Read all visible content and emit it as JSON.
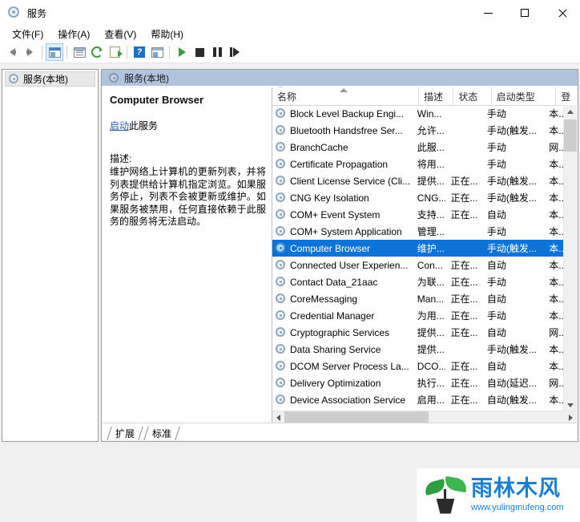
{
  "window": {
    "title": "服务",
    "icon": "services-gear-icon",
    "controls": {
      "minimize": "—",
      "maximize": "□",
      "close": "✕"
    }
  },
  "menubar": {
    "items": [
      {
        "label": "文件(F)",
        "name": "menu-file"
      },
      {
        "label": "操作(A)",
        "name": "menu-action"
      },
      {
        "label": "查看(V)",
        "name": "menu-view"
      },
      {
        "label": "帮助(H)",
        "name": "menu-help"
      }
    ]
  },
  "toolbar": {
    "buttons": [
      {
        "name": "back-button",
        "icon": "arrow-left-icon"
      },
      {
        "name": "forward-button",
        "icon": "arrow-right-icon"
      },
      {
        "name": "show-hide-tree-button",
        "icon": "tree-pane-icon",
        "selected": true
      },
      {
        "name": "properties-button",
        "icon": "properties-icon"
      },
      {
        "name": "refresh-button",
        "icon": "refresh-icon"
      },
      {
        "name": "export-list-button",
        "icon": "export-icon"
      },
      {
        "name": "help-button",
        "icon": "help-icon"
      },
      {
        "name": "console-view-button",
        "icon": "console-icon"
      },
      {
        "name": "start-service-button",
        "icon": "play-icon"
      },
      {
        "name": "stop-service-button",
        "icon": "stop-icon"
      },
      {
        "name": "pause-service-button",
        "icon": "pause-icon"
      },
      {
        "name": "restart-service-button",
        "icon": "restart-icon"
      }
    ]
  },
  "tree": {
    "root": {
      "label": "服务(本地)",
      "icon": "services-gear-icon",
      "selected": true
    }
  },
  "pane": {
    "header": {
      "label": "服务(本地)",
      "icon": "services-gear-icon"
    },
    "header_bg": "#b0c4de"
  },
  "details": {
    "service_name": "Computer Browser",
    "action_link": "启动",
    "action_suffix": "此服务",
    "description_label": "描述:",
    "description": "维护网络上计算机的更新列表，并将列表提供给计算机指定浏览。如果服务停止，列表不会被更新或维护。如果服务被禁用，任何直接依赖于此服务的服务将无法启动。"
  },
  "list": {
    "columns": [
      {
        "key": "name",
        "label": "名称",
        "sort": "asc"
      },
      {
        "key": "desc",
        "label": "描述"
      },
      {
        "key": "state",
        "label": "状态"
      },
      {
        "key": "start",
        "label": "启动类型"
      },
      {
        "key": "logon",
        "label": "登"
      }
    ],
    "selected_index": 8,
    "rows": [
      {
        "name": "Block Level Backup Engi...",
        "desc": "Win...",
        "state": "",
        "start": "手动",
        "logon": "本..."
      },
      {
        "name": "Bluetooth Handsfree Ser...",
        "desc": "允许...",
        "state": "",
        "start": "手动(触发...",
        "logon": "本..."
      },
      {
        "name": "BranchCache",
        "desc": "此服...",
        "state": "",
        "start": "手动",
        "logon": "网..."
      },
      {
        "name": "Certificate Propagation",
        "desc": "将用...",
        "state": "",
        "start": "手动",
        "logon": "本..."
      },
      {
        "name": "Client License Service (Cli...",
        "desc": "提供...",
        "state": "正在...",
        "start": "手动(触发...",
        "logon": "本..."
      },
      {
        "name": "CNG Key Isolation",
        "desc": "CNG...",
        "state": "正在...",
        "start": "手动(触发...",
        "logon": "本..."
      },
      {
        "name": "COM+ Event System",
        "desc": "支持...",
        "state": "正在...",
        "start": "自动",
        "logon": "本..."
      },
      {
        "name": "COM+ System Application",
        "desc": "管理...",
        "state": "",
        "start": "手动",
        "logon": "本..."
      },
      {
        "name": "Computer Browser",
        "desc": "维护...",
        "state": "",
        "start": "手动(触发...",
        "logon": "本..."
      },
      {
        "name": "Connected User Experien...",
        "desc": "Con...",
        "state": "正在...",
        "start": "自动",
        "logon": "本..."
      },
      {
        "name": "Contact Data_21aac",
        "desc": "为联...",
        "state": "正在...",
        "start": "手动",
        "logon": "本..."
      },
      {
        "name": "CoreMessaging",
        "desc": "Man...",
        "state": "正在...",
        "start": "自动",
        "logon": "本..."
      },
      {
        "name": "Credential Manager",
        "desc": "为用...",
        "state": "正在...",
        "start": "手动",
        "logon": "本..."
      },
      {
        "name": "Cryptographic Services",
        "desc": "提供...",
        "state": "正在...",
        "start": "自动",
        "logon": "网..."
      },
      {
        "name": "Data Sharing Service",
        "desc": "提供...",
        "state": "",
        "start": "手动(触发...",
        "logon": "本..."
      },
      {
        "name": "DCOM Server Process La...",
        "desc": "DCO...",
        "state": "正在...",
        "start": "自动",
        "logon": "本..."
      },
      {
        "name": "Delivery Optimization",
        "desc": "执行...",
        "state": "正在...",
        "start": "自动(延迟...",
        "logon": "网..."
      },
      {
        "name": "Device Association Service",
        "desc": "启用...",
        "state": "正在...",
        "start": "自动(触发...",
        "logon": "本..."
      }
    ]
  },
  "tabs": [
    {
      "label": "扩展",
      "name": "tab-extended"
    },
    {
      "label": "标准",
      "name": "tab-standard",
      "active": true
    }
  ],
  "watermark": {
    "name": "雨林木风",
    "url": "www.yulingmufeng.com",
    "color": "#1a7fd4"
  },
  "colors": {
    "selection": "#0e73d6",
    "pane_header": "#b0c4de",
    "link": "#2b5ea8"
  }
}
